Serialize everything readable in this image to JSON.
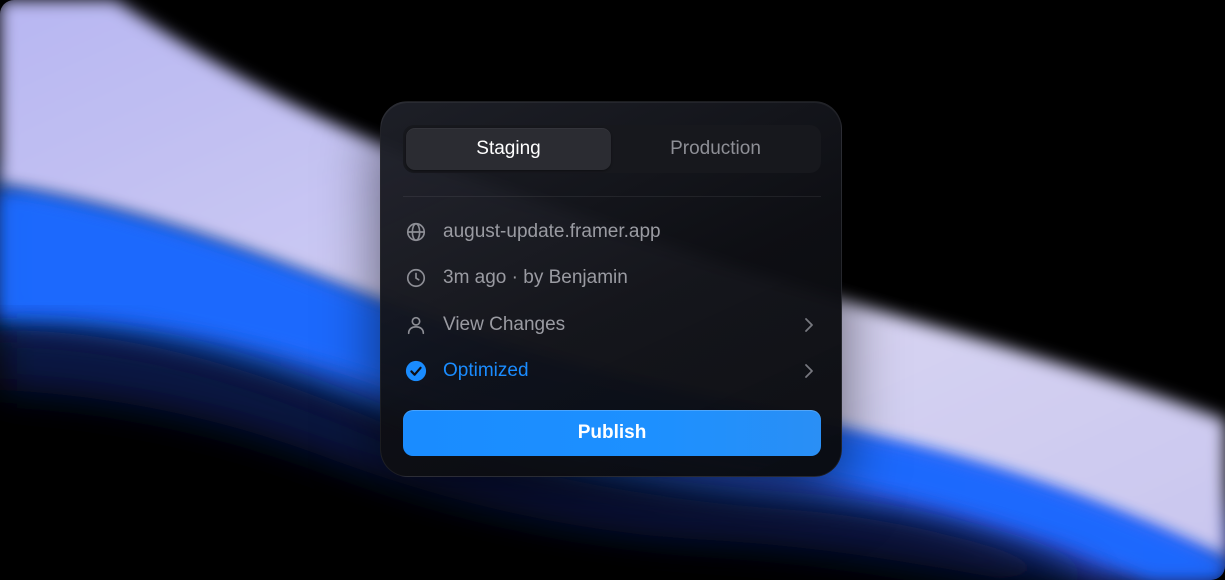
{
  "tabs": [
    {
      "label": "Staging",
      "active": true
    },
    {
      "label": "Production",
      "active": false
    }
  ],
  "rows": [
    {
      "icon": "globe-icon",
      "label": "august-update.framer.app"
    },
    {
      "icon": "clock-icon",
      "label": "3m ago · by Benjamin"
    },
    {
      "icon": "user-icon",
      "label": "View Changes",
      "chevron": true
    },
    {
      "icon": "check-circle-icon",
      "label": "Optimized",
      "chevron": true
    }
  ],
  "publish_label": "Publish",
  "colors": {
    "accent": "#1a8cff",
    "panel": "#15161b",
    "text_muted": "#9a9ba2",
    "background": "#000000"
  }
}
